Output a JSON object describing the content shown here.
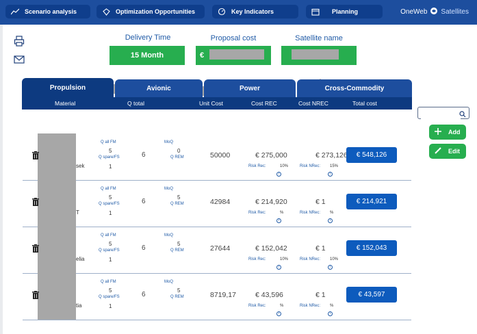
{
  "nav": [
    {
      "label": "Scenario analysis",
      "icon": "chart-icon"
    },
    {
      "label": "Optimization Opportunities",
      "icon": "diamond-icon"
    },
    {
      "label": "Key Indicators",
      "icon": "gauge-icon"
    },
    {
      "label": "Planning",
      "icon": "calendar-icon"
    }
  ],
  "brand": {
    "name": "OneWeb",
    "sub": "Satellites"
  },
  "summary": {
    "delivery_label": "Delivery Time",
    "delivery_value": "15 Month",
    "proposal_label": "Proposal cost",
    "proposal_prefix": "€",
    "satellite_label": "Satellite name"
  },
  "products": [
    {
      "icon": "propulsion-module-icon",
      "prefix": "€"
    },
    {
      "icon": "avionic-module-icon",
      "prefix": "€"
    },
    {
      "icon": "power-module-icon",
      "prefix": "€"
    },
    {
      "icon": "cross-commodity-module-icon",
      "prefix": "€"
    }
  ],
  "tabs": [
    "Propulsion",
    "Avionic",
    "Power",
    "Cross-Commodity"
  ],
  "columns": {
    "material": "Material",
    "q_total": "Q total",
    "unit_cost": "Unit Cost",
    "cost_rec": "Cost REC",
    "cost_nrec": "Cost NREC",
    "total_cost": "Total cost"
  },
  "labels": {
    "q_all_fm": "Q all FM",
    "q_spare": "Q spare/FS",
    "moq": "MoQ",
    "q_rem": "Q REM",
    "risk_rec": "Risk Rec:",
    "risk_nrec": "Risk NRec:"
  },
  "rows": [
    {
      "suffix": "sek",
      "q_all_fm": "5",
      "q_spare": "1",
      "q_total": "6",
      "moq": "0",
      "unit_cost": "50000",
      "cost_rec": "€ 275,000",
      "risk_rec": "10%",
      "cost_nrec": "€ 273,126",
      "risk_nrec": "15%",
      "total": "€ 548,126"
    },
    {
      "suffix": "T",
      "q_all_fm": "5",
      "q_spare": "1",
      "q_total": "6",
      "moq": "5",
      "unit_cost": "42984",
      "cost_rec": "€ 214,920",
      "risk_rec": "%",
      "cost_nrec": "€ 1",
      "risk_nrec": "%",
      "total": "€ 214,921"
    },
    {
      "suffix": "elia",
      "q_all_fm": "5",
      "q_spare": "1",
      "q_total": "6",
      "moq": "5",
      "unit_cost": "27644",
      "cost_rec": "€ 152,042",
      "risk_rec": "10%",
      "cost_nrec": "€ 1",
      "risk_nrec": "10%",
      "total": "€ 152,043"
    },
    {
      "suffix": "tia",
      "q_all_fm": "5",
      "q_spare": "1",
      "q_total": "6",
      "moq": "5",
      "unit_cost": "8719,17",
      "cost_rec": "€ 43,596",
      "risk_rec": "%",
      "cost_nrec": "€ 1",
      "risk_nrec": "%",
      "total": "€ 43,597"
    }
  ],
  "actions": {
    "add": "Add",
    "edit": "Edit"
  },
  "search": {
    "placeholder": ""
  }
}
